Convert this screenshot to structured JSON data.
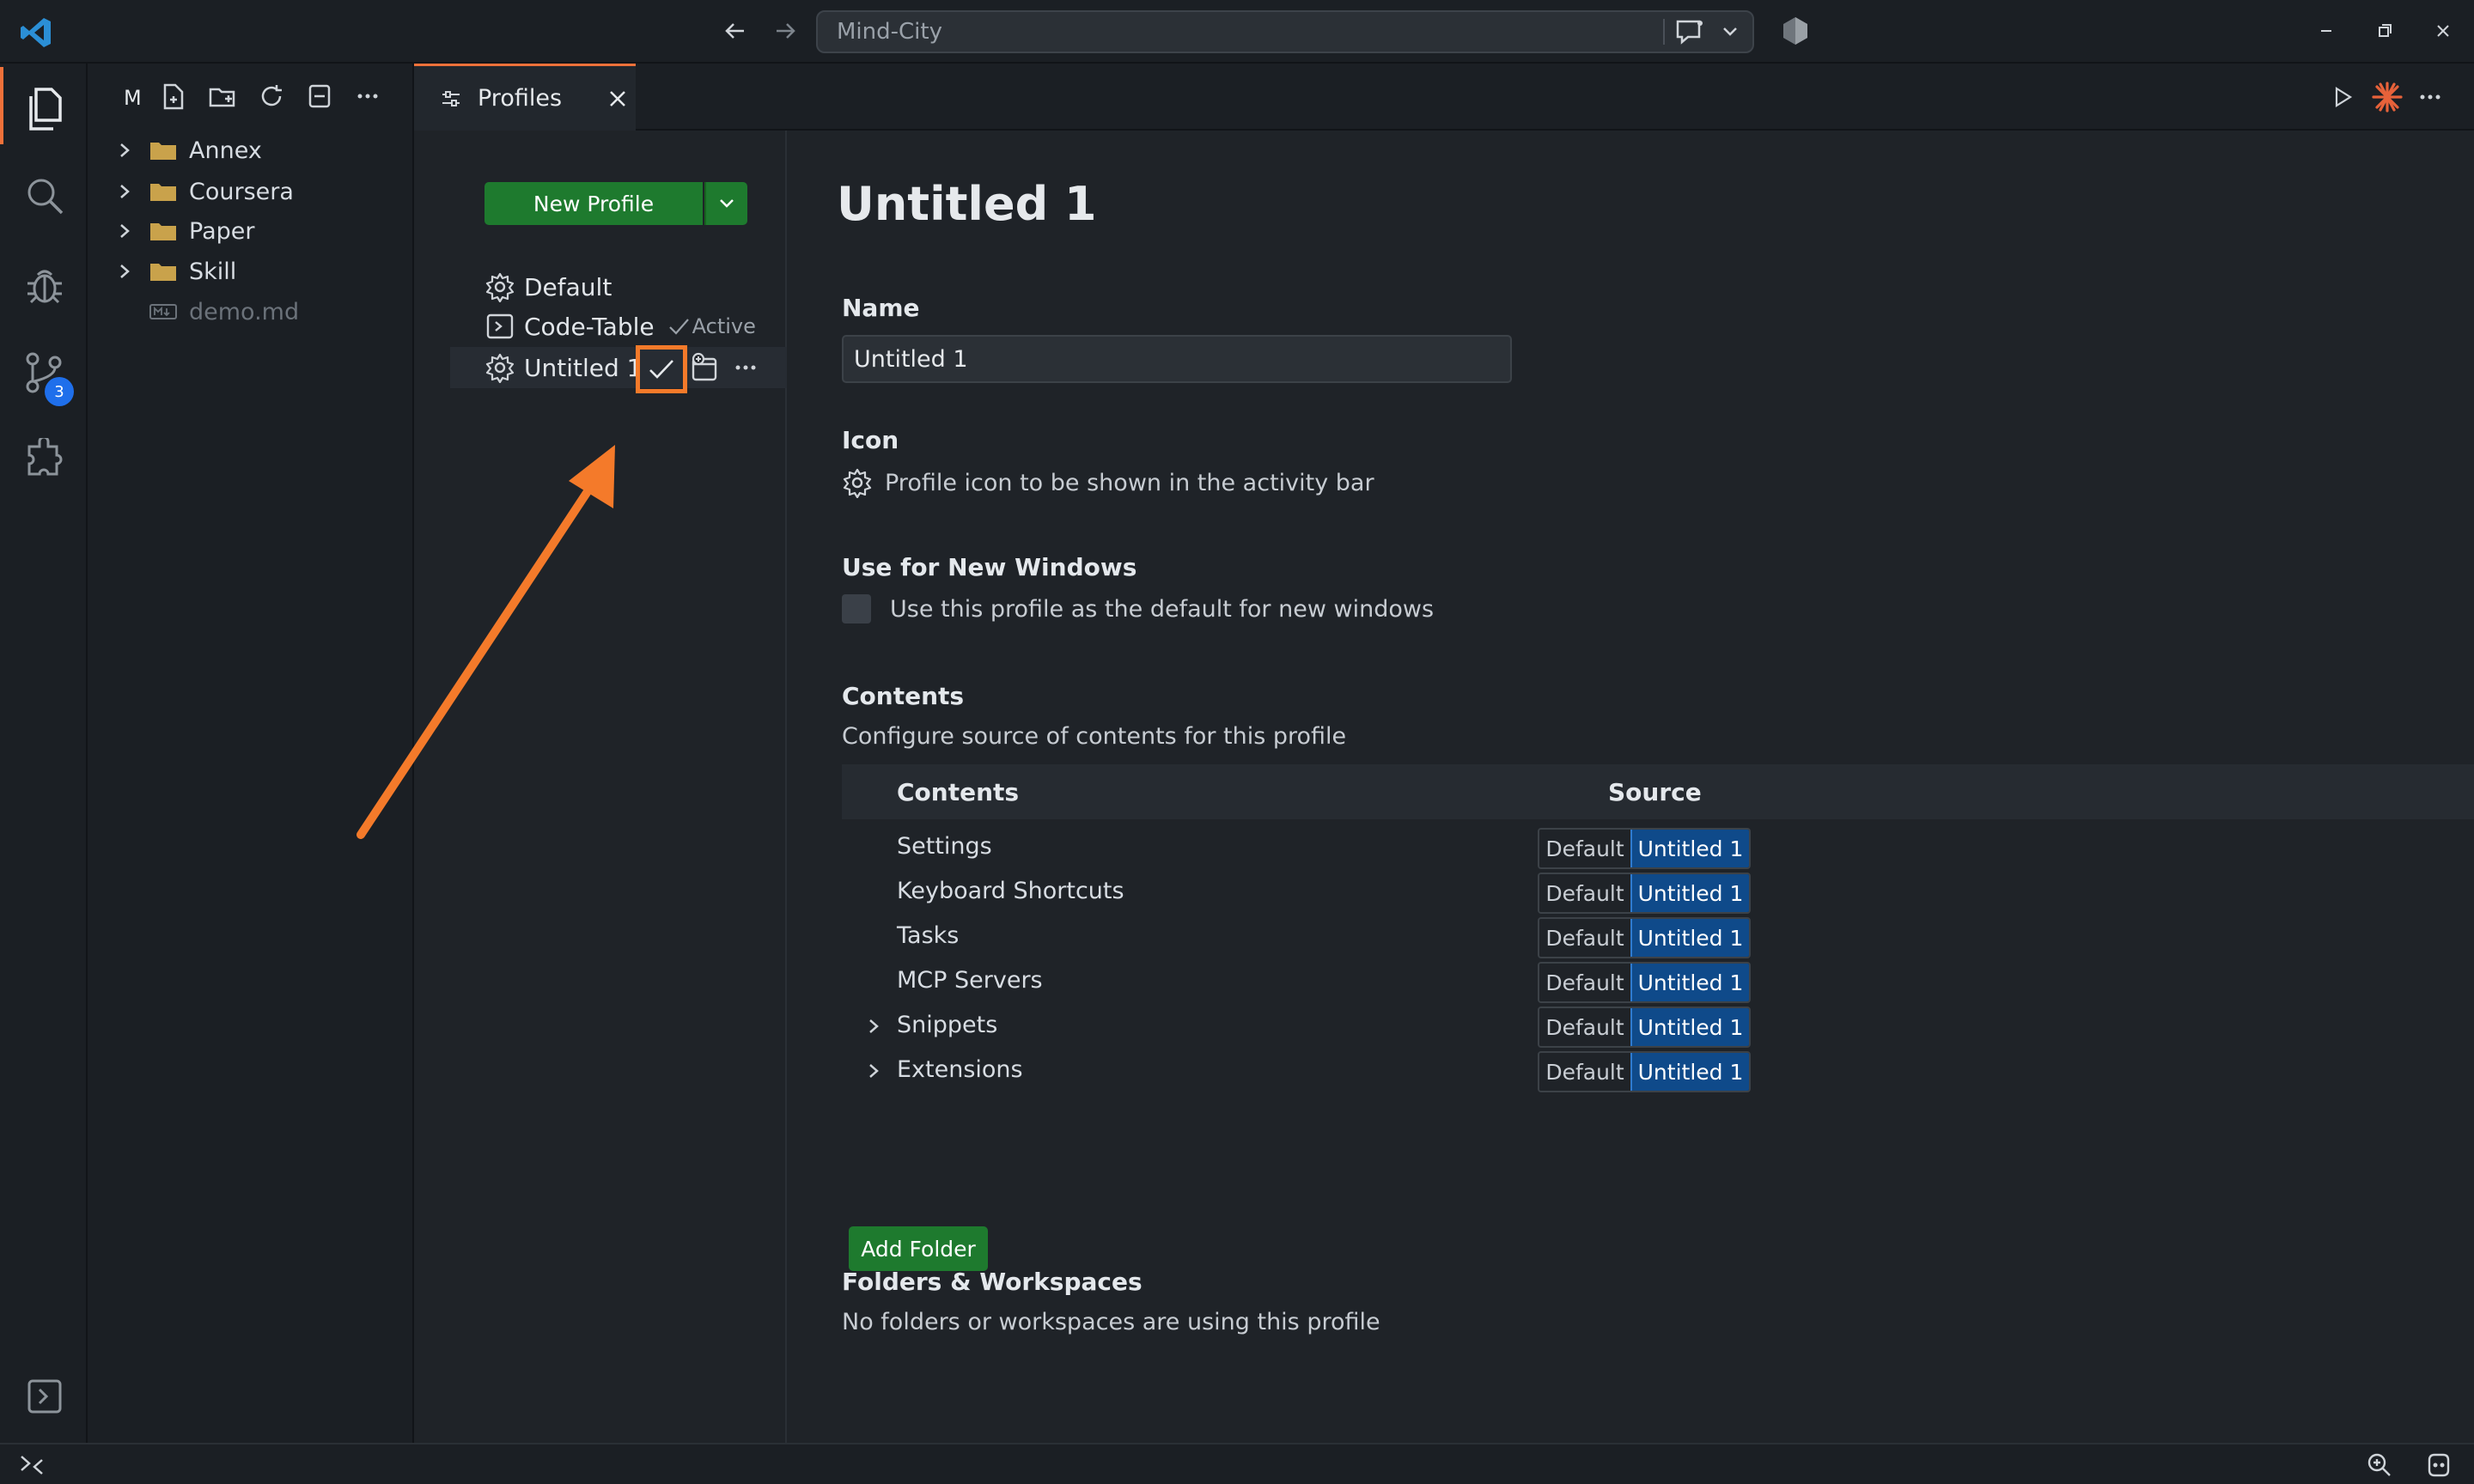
{
  "titlebar": {
    "search_text": "Mind-City"
  },
  "explorer": {
    "header_initial": "M",
    "items": [
      {
        "label": "Annex",
        "type": "folder"
      },
      {
        "label": "Coursera",
        "type": "folder"
      },
      {
        "label": "Paper",
        "type": "folder"
      },
      {
        "label": "Skill",
        "type": "folder"
      },
      {
        "label": "demo.md",
        "type": "file"
      }
    ]
  },
  "activity": {
    "source_control_badge": "3"
  },
  "tab": {
    "label": "Profiles"
  },
  "profiles": {
    "new_profile_label": "New Profile",
    "items": [
      {
        "label": "Default",
        "icon": "gear-icon"
      },
      {
        "label": "Code-Table",
        "icon": "terminal-icon",
        "status": "Active"
      },
      {
        "label": "Untitled 1",
        "icon": "gear-icon"
      }
    ]
  },
  "editor": {
    "title": "Untitled 1",
    "name_heading": "Name",
    "name_value": "Untitled 1",
    "icon_heading": "Icon",
    "icon_desc": "Profile icon to be shown in the activity bar",
    "new_windows_heading": "Use for New Windows",
    "new_windows_desc": "Use this profile as the default for new windows",
    "contents_heading": "Contents",
    "contents_desc": "Configure source of contents for this profile",
    "table_col_contents": "Contents",
    "table_col_source": "Source",
    "rows": [
      {
        "label": "Settings",
        "expandable": false,
        "default_label": "Default",
        "profile_label": "Untitled 1"
      },
      {
        "label": "Keyboard Shortcuts",
        "expandable": false,
        "default_label": "Default",
        "profile_label": "Untitled 1"
      },
      {
        "label": "Tasks",
        "expandable": false,
        "default_label": "Default",
        "profile_label": "Untitled 1"
      },
      {
        "label": "MCP Servers",
        "expandable": false,
        "default_label": "Default",
        "profile_label": "Untitled 1"
      },
      {
        "label": "Snippets",
        "expandable": true,
        "default_label": "Default",
        "profile_label": "Untitled 1"
      },
      {
        "label": "Extensions",
        "expandable": true,
        "default_label": "Default",
        "profile_label": "Untitled 1"
      }
    ],
    "folders_heading": "Folders & Workspaces",
    "folders_desc": "No folders or workspaces are using this profile",
    "add_folder_label": "Add Folder"
  },
  "colors": {
    "accent_orange": "#f47a2a",
    "green": "#1e7a2e",
    "blue": "#0f4a8a"
  }
}
